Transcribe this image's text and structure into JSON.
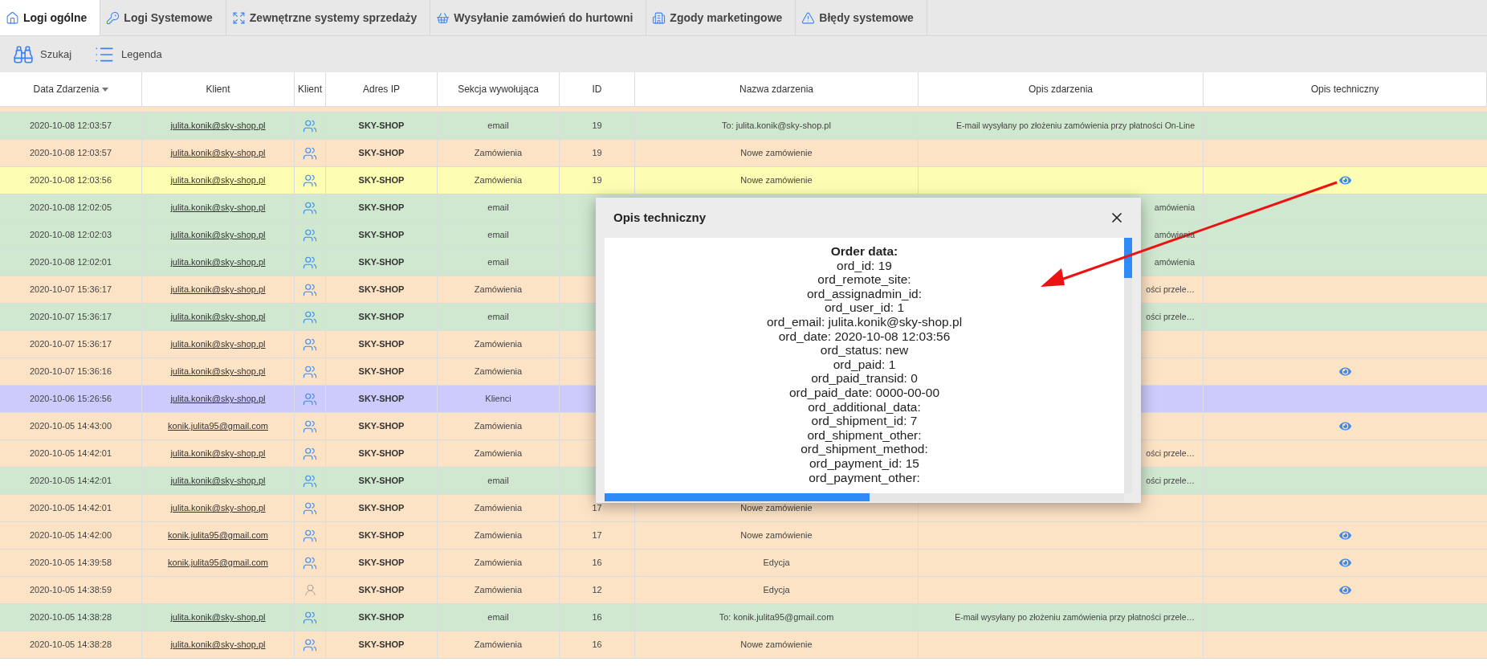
{
  "tabs": [
    {
      "label": "Logi ogólne",
      "kind": "home",
      "selected": true
    },
    {
      "label": "Logi Systemowe",
      "kind": "key",
      "selected": false
    },
    {
      "label": "Zewnętrzne systemy sprzedaży",
      "kind": "expand",
      "selected": false
    },
    {
      "label": "Wysyłanie zamówień do hurtowni",
      "kind": "basket",
      "selected": false
    },
    {
      "label": "Zgody marketingowe",
      "kind": "building",
      "selected": false
    },
    {
      "label": "Błędy systemowe",
      "kind": "warning",
      "selected": false
    }
  ],
  "toolbar": [
    {
      "label": "Szukaj",
      "kind": "binoculars"
    },
    {
      "label": "Legenda",
      "kind": "list"
    }
  ],
  "table": {
    "columns": [
      {
        "label": "Data Zdarzenia",
        "sorted": true
      },
      {
        "label": "Klient",
        "sorted": false
      },
      {
        "label": "Klient",
        "sorted": false
      },
      {
        "label": "Adres IP",
        "sorted": false
      },
      {
        "label": "Sekcja wywołująca",
        "sorted": false
      },
      {
        "label": "ID",
        "sorted": false
      },
      {
        "label": "Nazwa zdarzenia",
        "sorted": false
      },
      {
        "label": "Opis zdarzenia",
        "sorted": false
      },
      {
        "label": "Opis techniczny",
        "sorted": false
      }
    ],
    "rows": [
      {
        "color": "#d0e8d0",
        "date": "2020-10-08 12:03:57",
        "client": "julita.konik@sky-shop.pl",
        "kind": "group",
        "ip": "SKY-SHOP",
        "section": "email",
        "id": "19",
        "event": "To: julita.konik@sky-shop.pl",
        "description": "E-mail wysyłany po złożeniu zamówienia przy płatności On-Line",
        "details": false
      },
      {
        "color": "#fde3c6",
        "date": "2020-10-08 12:03:57",
        "client": "julita.konik@sky-shop.pl",
        "kind": "group",
        "ip": "SKY-SHOP",
        "section": "Zamówienia",
        "id": "19",
        "event": "Nowe zamówienie",
        "details": false
      },
      {
        "color": "#fdfdb4",
        "date": "2020-10-08 12:03:56",
        "client": "julita.konik@sky-shop.pl",
        "kind": "group",
        "ip": "SKY-SHOP",
        "section": "Zamówienia",
        "id": "19",
        "event": "Nowe zamówienie",
        "details": true
      },
      {
        "color": "#d0e8d0",
        "date": "2020-10-08 12:02:05",
        "client": "julita.konik@sky-shop.pl",
        "kind": "group",
        "ip": "SKY-SHOP",
        "section": "email",
        "description": "amówienia",
        "details": false
      },
      {
        "color": "#d0e8d0",
        "date": "2020-10-08 12:02:03",
        "client": "julita.konik@sky-shop.pl",
        "kind": "group",
        "ip": "SKY-SHOP",
        "section": "email",
        "description": "amówienia",
        "details": false
      },
      {
        "color": "#d0e8d0",
        "date": "2020-10-08 12:02:01",
        "client": "julita.konik@sky-shop.pl",
        "kind": "group",
        "ip": "SKY-SHOP",
        "section": "email",
        "description": "amówienia",
        "details": false
      },
      {
        "color": "#fde3c6",
        "date": "2020-10-07 15:36:17",
        "client": "julita.konik@sky-shop.pl",
        "kind": "group",
        "ip": "SKY-SHOP",
        "section": "Zamówienia",
        "description": "ości przele…",
        "details": false
      },
      {
        "color": "#d0e8d0",
        "date": "2020-10-07 15:36:17",
        "client": "julita.konik@sky-shop.pl",
        "kind": "group",
        "ip": "SKY-SHOP",
        "section": "email",
        "description": "ości przele…",
        "details": false
      },
      {
        "color": "#fde3c6",
        "date": "2020-10-07 15:36:17",
        "client": "julita.konik@sky-shop.pl",
        "kind": "group",
        "ip": "SKY-SHOP",
        "section": "Zamówienia",
        "details": false
      },
      {
        "color": "#fde3c6",
        "date": "2020-10-07 15:36:16",
        "client": "julita.konik@sky-shop.pl",
        "kind": "group",
        "ip": "SKY-SHOP",
        "section": "Zamówienia",
        "details": true
      },
      {
        "color": "#cccbfb",
        "date": "2020-10-06 15:26:56",
        "client": "julita.konik@sky-shop.pl",
        "kind": "group",
        "ip": "SKY-SHOP",
        "section": "Klienci",
        "details": false
      },
      {
        "color": "#fde3c6",
        "date": "2020-10-05 14:43:00",
        "client": "konik.julita95@gmail.com",
        "kind": "group",
        "ip": "SKY-SHOP",
        "section": "Zamówienia",
        "details": true
      },
      {
        "color": "#fde3c6",
        "date": "2020-10-05 14:42:01",
        "client": "julita.konik@sky-shop.pl",
        "kind": "group",
        "ip": "SKY-SHOP",
        "section": "Zamówienia",
        "description": "ości przele…",
        "details": false
      },
      {
        "color": "#d0e8d0",
        "date": "2020-10-05 14:42:01",
        "client": "julita.konik@sky-shop.pl",
        "kind": "group",
        "ip": "SKY-SHOP",
        "section": "email",
        "description": "ości przele…",
        "details": false
      },
      {
        "color": "#fde3c6",
        "date": "2020-10-05 14:42:01",
        "client": "julita.konik@sky-shop.pl",
        "kind": "group",
        "ip": "SKY-SHOP",
        "section": "Zamówienia",
        "id": "17",
        "event": "Nowe zamówienie",
        "details": false
      },
      {
        "color": "#fde3c6",
        "date": "2020-10-05 14:42:00",
        "client": "konik.julita95@gmail.com",
        "kind": "group",
        "ip": "SKY-SHOP",
        "section": "Zamówienia",
        "id": "17",
        "event": "Nowe zamówienie",
        "details": true
      },
      {
        "color": "#fde3c6",
        "date": "2020-10-05 14:39:58",
        "client": "konik.julita95@gmail.com",
        "kind": "group",
        "ip": "SKY-SHOP",
        "section": "Zamówienia",
        "id": "16",
        "event": "Edycja",
        "details": true
      },
      {
        "color": "#fde3c6",
        "date": "2020-10-05 14:38:59",
        "kind": "single",
        "ip": "SKY-SHOP",
        "section": "Zamówienia",
        "id": "12",
        "event": "Edycja",
        "details": true
      },
      {
        "color": "#d0e8d0",
        "date": "2020-10-05 14:38:28",
        "client": "julita.konik@sky-shop.pl",
        "kind": "group",
        "ip": "SKY-SHOP",
        "section": "email",
        "id": "16",
        "event": "To: konik.julita95@gmail.com",
        "description": "E-mail wysyłany po złożeniu zamówienia przy płatności przele…",
        "details": false
      },
      {
        "color": "#fde3c6",
        "date": "2020-10-05 14:38:28",
        "client": "julita.konik@sky-shop.pl",
        "kind": "group",
        "ip": "SKY-SHOP",
        "section": "Zamówienia",
        "id": "16",
        "event": "Nowe zamówienie",
        "details": false
      }
    ]
  },
  "dialog": {
    "title": "Opis techniczny",
    "lines": [
      {
        "text": "Order data:",
        "bold": true
      },
      {
        "text": "ord_id: 19",
        "bold": false
      },
      {
        "text": "ord_remote_site:",
        "bold": false
      },
      {
        "text": "ord_assignadmin_id:",
        "bold": false
      },
      {
        "text": "ord_user_id: 1",
        "bold": false
      },
      {
        "text": "ord_email: julita.konik@sky-shop.pl",
        "bold": false
      },
      {
        "text": "ord_date: 2020-10-08 12:03:56",
        "bold": false
      },
      {
        "text": "ord_status: new",
        "bold": false
      },
      {
        "text": "ord_paid: 1",
        "bold": false
      },
      {
        "text": "ord_paid_transid: 0",
        "bold": false
      },
      {
        "text": "ord_paid_date: 0000-00-00",
        "bold": false
      },
      {
        "text": "ord_additional_data:",
        "bold": false
      },
      {
        "text": "ord_shipment_id: 7",
        "bold": false
      },
      {
        "text": "ord_shipment_other:",
        "bold": false
      },
      {
        "text": "ord_shipment_method:",
        "bold": false
      },
      {
        "text": "ord_payment_id: 15",
        "bold": false
      },
      {
        "text": "ord_payment_other:",
        "bold": false
      }
    ]
  }
}
